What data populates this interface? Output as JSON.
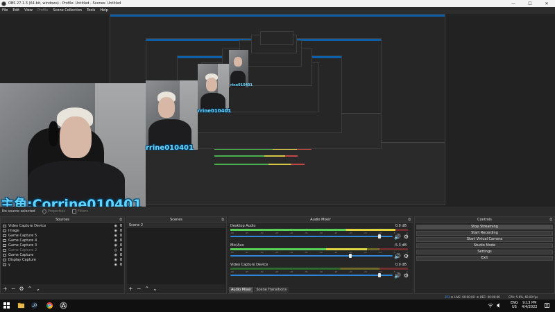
{
  "window": {
    "title": "OBS 27.1.3 (64-bit, windows) - Profile: Untitled - Scenes: Untitled",
    "minimize": "—",
    "maximize": "☐",
    "close": "✕"
  },
  "menu": {
    "file": "File",
    "edit": "Edit",
    "view": "View",
    "profile": "Profile",
    "scene_collection": "Scene Collection",
    "tools": "Tools",
    "help": "Help"
  },
  "overlay": {
    "big": "主角:Corrine010401",
    "mid": "rrine010401",
    "small": "rrine010401",
    "tiny": "rine010401"
  },
  "context": {
    "no_source": "No source selected",
    "properties": "Properties",
    "filters": "Filters"
  },
  "sources": {
    "title": "Sources",
    "items": [
      {
        "name": "Video Capture Device",
        "icon": "camera-icon"
      },
      {
        "name": "Image",
        "icon": "image-icon"
      },
      {
        "name": "Game Capture 5",
        "icon": "game-icon"
      },
      {
        "name": "Game Capture 4",
        "icon": "game-icon"
      },
      {
        "name": "Game Capture 3",
        "icon": "game-icon"
      },
      {
        "name": "Game Capture 2",
        "icon": "game-icon"
      },
      {
        "name": "Game Capture",
        "icon": "game-icon"
      },
      {
        "name": "Display Capture",
        "icon": "monitor-icon"
      },
      {
        "name": "y",
        "icon": "text-icon"
      }
    ]
  },
  "scenes": {
    "title": "Scenes",
    "items": [
      "Scene 2"
    ]
  },
  "mixer": {
    "title": "Audio Mixer",
    "channels": [
      {
        "name": "Desktop Audio",
        "db": "0.0 dB",
        "level": 0.93,
        "volume": 0.92
      },
      {
        "name": "Mic/Aux",
        "db": "-5.3 dB",
        "level": 0.77,
        "volume": 0.74
      },
      {
        "name": "Video Capture Device",
        "db": "0.0 dB",
        "level": 0.0,
        "volume": 0.92
      }
    ],
    "ticks": [
      "-60",
      "-55",
      "-50",
      "-45",
      "-40",
      "-35",
      "-30",
      "-25",
      "-20",
      "-15",
      "-10",
      "-5",
      "0"
    ],
    "tabs": {
      "mixer": "Audio Mixer",
      "transitions": "Scene Transitions"
    }
  },
  "controls": {
    "title": "Controls",
    "stop_streaming": "Stop Streaming",
    "start_recording": "Start Recording",
    "start_virtual_camera": "Start Virtual Camera",
    "studio_mode": "Studio Mode",
    "settings": "Settings",
    "exit": "Exit"
  },
  "status": {
    "dropped": "3F3",
    "live": "LIVE: 00:00:00",
    "rec": "REC: 00:00:00",
    "cpu": "CPU: 5.6%, 60.00 fps"
  },
  "taskbar": {
    "lang_line1": "ENG",
    "lang_line2": "US",
    "time": "9:13 PM",
    "date": "4/4/2022"
  },
  "colors": {
    "accent": "#0f5ea8",
    "overlay_text": "#5fd4ff",
    "meter_green": "#5bd05b",
    "meter_yellow": "#e0d640",
    "slider_blue": "#2e86d6"
  }
}
